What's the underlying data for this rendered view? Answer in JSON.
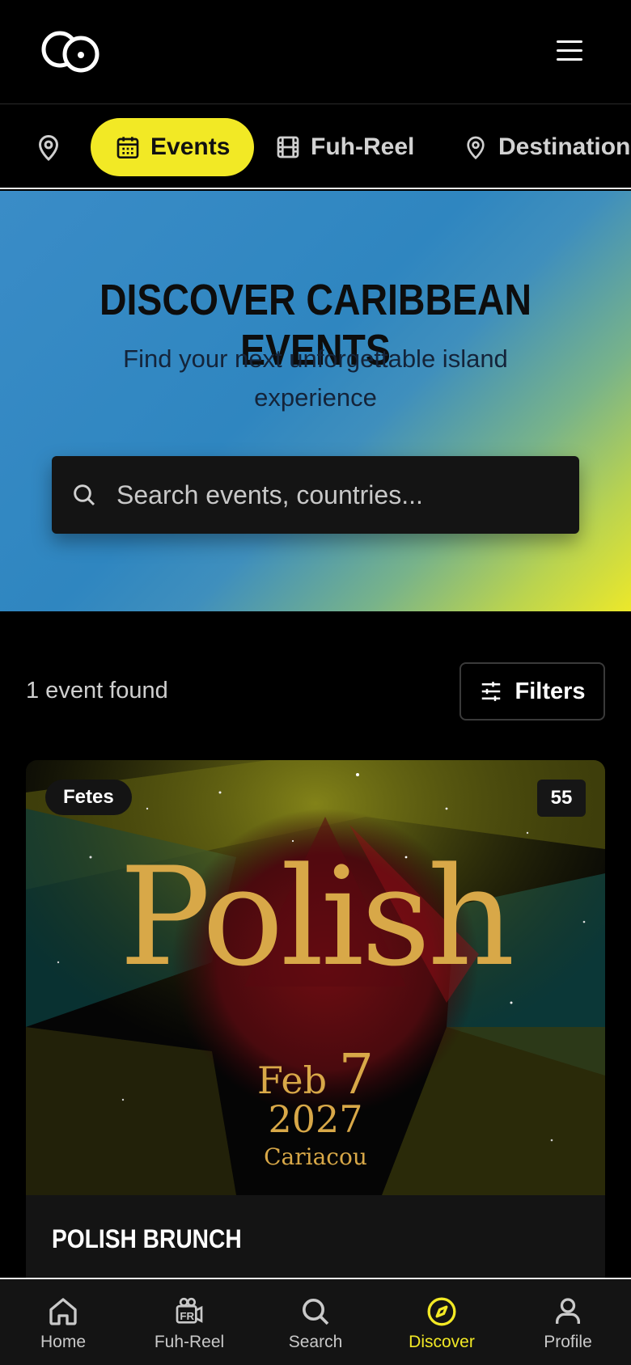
{
  "header": {
    "logo_icon": "double-circle-logo",
    "menu_icon": "hamburger-icon"
  },
  "tabs": [
    {
      "icon": "map-pin-icon",
      "label": ""
    },
    {
      "icon": "calendar-icon",
      "label": "Events",
      "active": true
    },
    {
      "icon": "film-icon",
      "label": "Fuh-Reel"
    },
    {
      "icon": "map-pin-icon",
      "label": "Destinations"
    }
  ],
  "hero": {
    "title": "DISCOVER CARIBBEAN EVENTS",
    "subtitle": "Find your next unforgettable island experience",
    "search_placeholder": "Search events, countries..."
  },
  "results": {
    "count_text": "1 event found",
    "filters_label": "Filters"
  },
  "event": {
    "category": "Fetes",
    "count": "55",
    "title": "POLISH BRUNCH",
    "poster": {
      "name": "Polish",
      "month": "Feb",
      "day": "7",
      "year": "2027",
      "place": "Cariacou"
    }
  },
  "bottom_nav": [
    {
      "icon": "home-icon",
      "label": "Home"
    },
    {
      "icon": "fuh-reel-icon",
      "label": "Fuh-Reel"
    },
    {
      "icon": "search-icon",
      "label": "Search"
    },
    {
      "icon": "compass-icon",
      "label": "Discover",
      "active": true
    },
    {
      "icon": "user-icon",
      "label": "Profile"
    }
  ],
  "colors": {
    "accent": "#f2e925",
    "hero_blue": "#2f86c0",
    "poster_gold": "#d8a848"
  }
}
